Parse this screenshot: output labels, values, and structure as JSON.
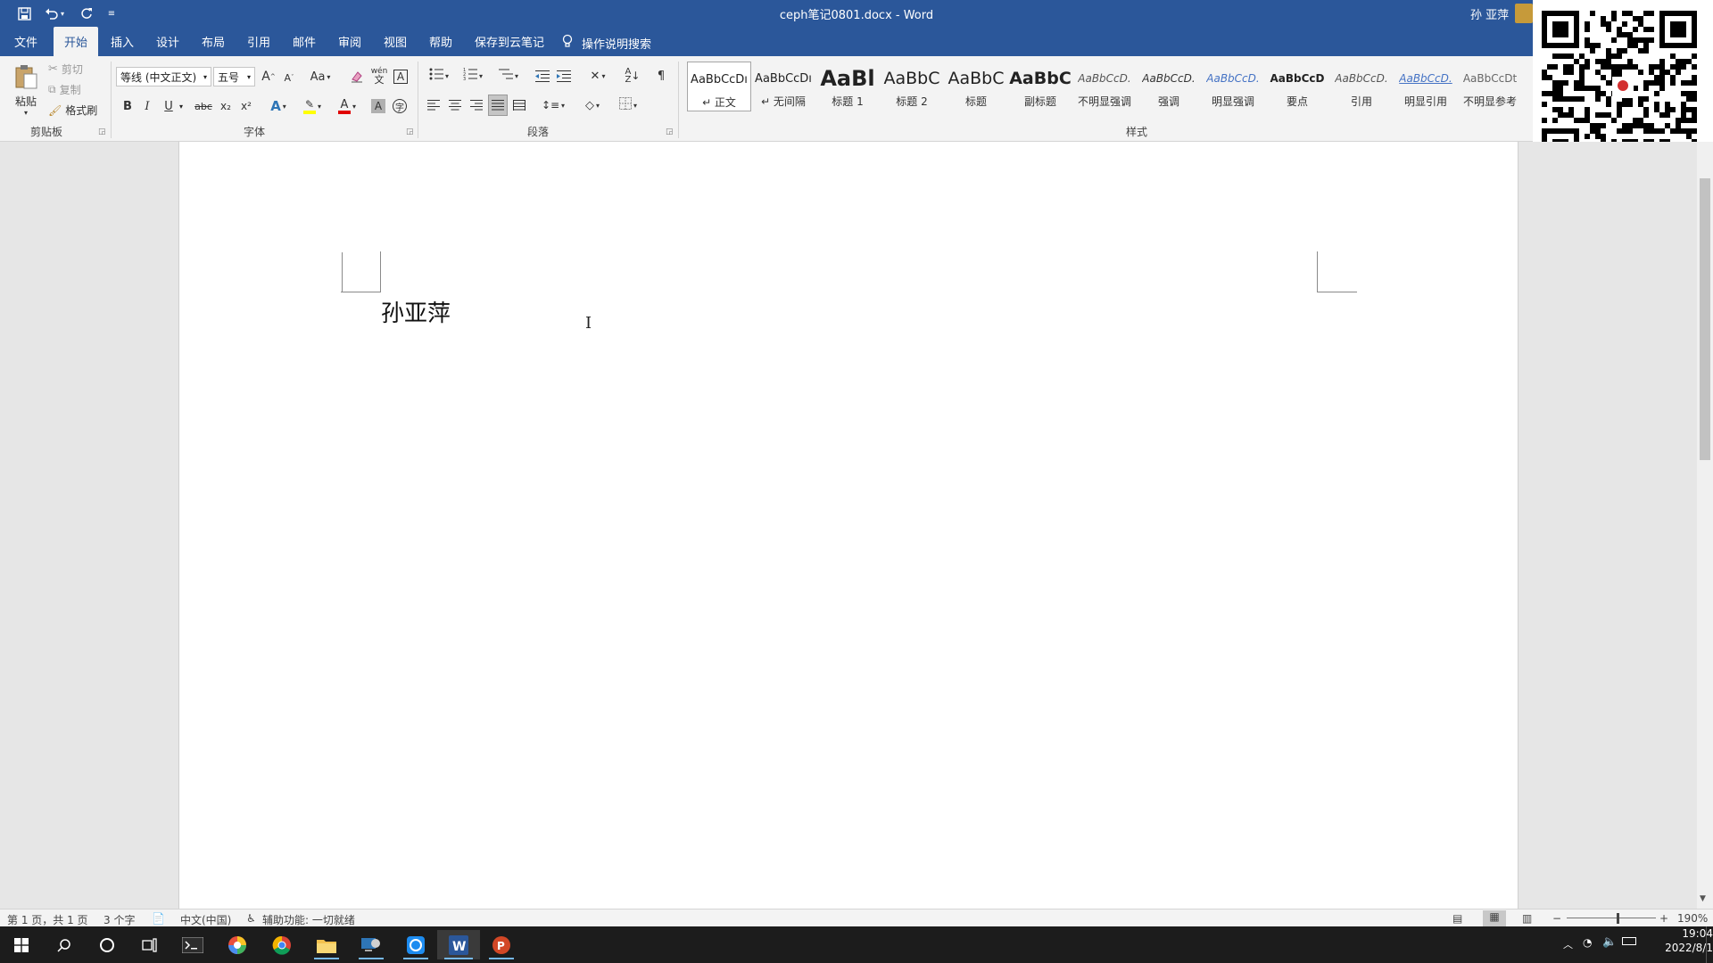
{
  "window": {
    "title": "ceph笔记0801.docx  -  Word",
    "user": "孙 亚萍"
  },
  "tabs": [
    "文件",
    "开始",
    "插入",
    "设计",
    "布局",
    "引用",
    "邮件",
    "审阅",
    "视图",
    "帮助",
    "保存到云笔记"
  ],
  "active_tab": "开始",
  "tell_me": "操作说明搜索",
  "clipboard": {
    "paste": "粘贴",
    "cut": "剪切",
    "copy": "复制",
    "format_painter": "格式刷",
    "label": "剪贴板"
  },
  "font": {
    "name": "等线 (中文正文)",
    "size": "五号",
    "label": "字体",
    "bold": "B",
    "italic": "I",
    "underline": "U",
    "strike": "abc",
    "sub": "x₂",
    "sup": "x²",
    "grow": "A",
    "shrink": "A",
    "case": "Aa",
    "font_color_letter": "A",
    "wen": "wén",
    "highlight_color": "#ffff00",
    "font_color": "#e00000"
  },
  "paragraph": {
    "label": "段落"
  },
  "styles": {
    "label": "样式",
    "items": [
      {
        "preview": "AaBbCcDı",
        "name": "正文",
        "selected": true
      },
      {
        "preview": "AaBbCcDı",
        "name": "无间隔"
      },
      {
        "preview": "AaBl",
        "name": "标题 1"
      },
      {
        "preview": "AaBbC",
        "name": "标题 2"
      },
      {
        "preview": "AaBbC",
        "name": "标题"
      },
      {
        "preview": "AaBbC",
        "name": "副标题"
      },
      {
        "preview": "AaBbCcD.",
        "name": "不明显强调"
      },
      {
        "preview": "AaBbCcD.",
        "name": "强调"
      },
      {
        "preview": "AaBbCcD.",
        "name": "明显强调"
      },
      {
        "preview": "AaBbCcD",
        "name": "要点"
      },
      {
        "preview": "AaBbCcD.",
        "name": "引用"
      },
      {
        "preview": "AaBbCcD.",
        "name": "明显引用"
      },
      {
        "preview": "AaBbCcDt",
        "name": "不明显参考"
      }
    ]
  },
  "document": {
    "text": "孙亚萍"
  },
  "status": {
    "page": "第 1 页，共 1 页",
    "words": "3 个字",
    "language": "中文(中国)",
    "accessibility": "辅助功能: 一切就绪",
    "zoom": "190%"
  },
  "clock": {
    "time": "19:04",
    "date": "2022/8/1"
  },
  "colors": {
    "accent": "#2b579a",
    "taskbar": "#1c1c1c"
  }
}
